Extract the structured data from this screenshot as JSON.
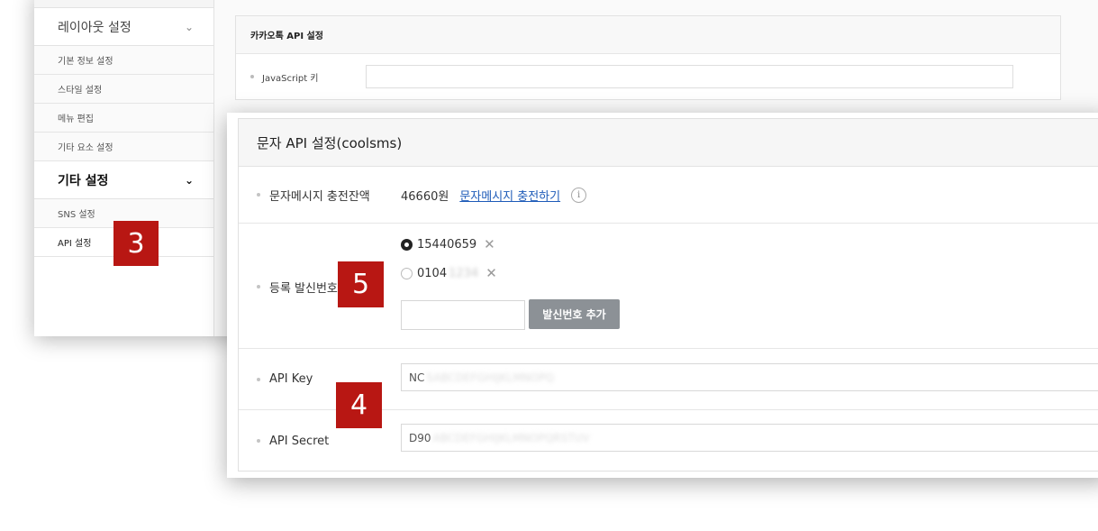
{
  "sidebar": {
    "layout_header": "레이아웃 설정",
    "layout_items": [
      "기본 정보 설정",
      "스타일 설정",
      "메뉴 편집",
      "기타 요소 설정"
    ],
    "other_header": "기타 설정",
    "other_items": [
      "SNS 설정",
      "API 설정"
    ]
  },
  "kakao": {
    "title": "카카오톡 API 설정",
    "js_key_label": "JavaScript 키"
  },
  "sms": {
    "title": "문자 API 설정(coolsms)",
    "balance_label": "문자메시지 충전잔액",
    "balance_value": "46660원",
    "charge_link": "문자메시지 충전하기",
    "info_icon": "i",
    "sender_label": "등록 발신번호",
    "sender_numbers": [
      {
        "visible": "15440659",
        "blurred": "",
        "selected": true
      },
      {
        "visible": "0104",
        "blurred": "1234",
        "selected": false
      }
    ],
    "add_sender_button": "발신번호 추가",
    "api_key_label": "API Key",
    "api_key_value": "NC",
    "api_key_blurred": "SABCDEFGHIJKLMNOPQ",
    "api_secret_label": "API Secret",
    "api_secret_value": "D90",
    "api_secret_blurred": "ABCDEFGHIJKLMNOPQRSTUV"
  },
  "badges": {
    "api_settings": "3",
    "api_key": "4",
    "sender": "5"
  },
  "colors": {
    "badge": "#b81713",
    "link": "#1e5bb8",
    "button": "#8c9196"
  }
}
